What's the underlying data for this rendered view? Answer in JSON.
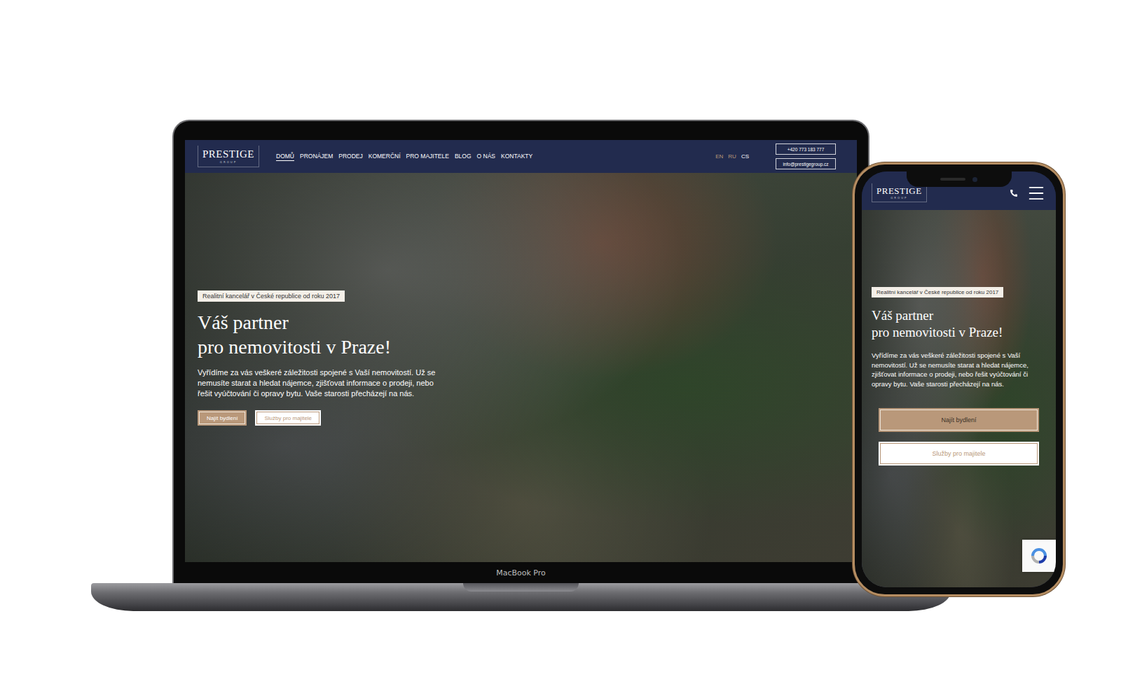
{
  "laptop": {
    "label": "MacBook Pro"
  },
  "site": {
    "logo": {
      "name": "PRESTIGE",
      "sub": "GROUP"
    },
    "nav": [
      {
        "label": "DOMŮ",
        "selected": true
      },
      {
        "label": "PRONÁJEM",
        "selected": false
      },
      {
        "label": "PRODEJ",
        "selected": false
      },
      {
        "label": "KOMERČNÍ",
        "selected": false
      },
      {
        "label": "PRO MAJITELE",
        "selected": false
      },
      {
        "label": "BLOG",
        "selected": false
      },
      {
        "label": "O NÁS",
        "selected": false
      },
      {
        "label": "KONTAKTY",
        "selected": false
      }
    ],
    "languages": [
      {
        "label": "EN",
        "selected": false
      },
      {
        "label": "RU",
        "selected": false
      },
      {
        "label": "CS",
        "selected": true
      }
    ],
    "phone": "+420 773 183 777",
    "email": "info@prestigegroup.cz",
    "hero": {
      "badge": "Realitní kancelář v České republice od roku 2017",
      "title_lines": [
        "Váš partner",
        "pro nemovitosti v Praze!"
      ],
      "text": "Vyřídíme za vás veškeré záležitosti spojené s Vaší nemovitostí. Už se nemusíte starat a hledat nájemce, zjišťovat informace o prodeji, nebo řešit vyúčtování či opravy bytu. Vaše starosti přecházejí na nás.",
      "buttons": [
        {
          "label": "Najít bydlení",
          "kind": "primary"
        },
        {
          "label": "Služby pro majitele",
          "kind": "secondary"
        }
      ]
    }
  }
}
